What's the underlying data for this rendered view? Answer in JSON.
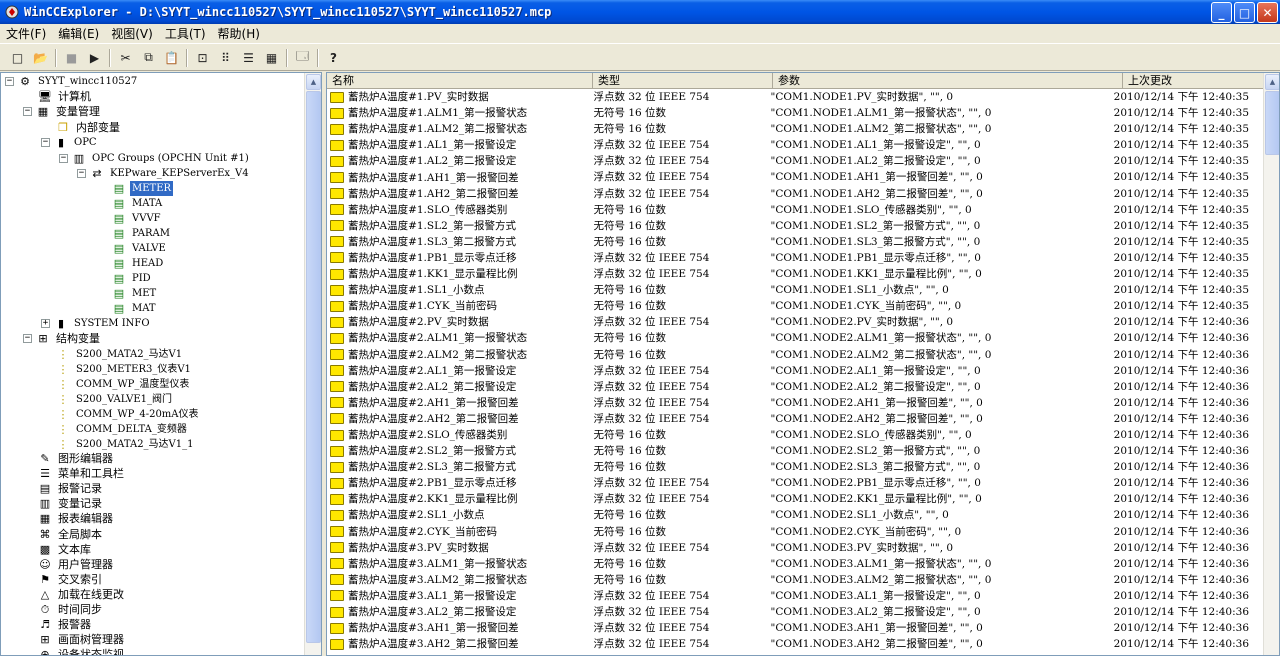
{
  "window": {
    "title": "WinCCExplorer - D:\\SYYT_wincc110527\\SYYT_wincc110527\\SYYT_wincc110527.mcp",
    "min_label": "_",
    "max_label": "□",
    "close_label": "✕"
  },
  "menubar": [
    "文件(F)",
    "编辑(E)",
    "视图(V)",
    "工具(T)",
    "帮助(H)"
  ],
  "toolbar": {
    "new_icon": "□",
    "open_icon": "📂",
    "stop_icon": "■",
    "run_icon": "▶",
    "cut_icon": "✂",
    "copy_icon": "⧉",
    "paste_icon": "📋",
    "large_icons": "⊡",
    "small_icons": "⠿",
    "list_view": "☰",
    "details_view": "▦",
    "properties_icon": "🗔",
    "help_icon": "?"
  },
  "tree": {
    "root": "SYYT_wincc110527",
    "computer": "计算机",
    "tag_management": "变量管理",
    "internal_tags": "内部变量",
    "opc": "OPC",
    "opc_groups": "OPC Groups (OPCHN Unit #1)",
    "kepware": "KEPware_KEPServerEx_V4",
    "groups": [
      "METER",
      "MATA",
      "VVVF",
      "PARAM",
      "VALVE",
      "HEAD",
      "PID",
      "MET",
      "MAT"
    ],
    "selected_group": "METER",
    "system_info": "SYSTEM INFO",
    "struct_tags": "结构变量",
    "structs": [
      "S200_MATA2_马达V1",
      "S200_METER3_仪表V1",
      "COMM_WP_温度型仪表",
      "S200_VALVE1_阀门",
      "COMM_WP_4-20mA仪表",
      "COMM_DELTA_变频器",
      "S200_MATA2_马达V1_1"
    ],
    "editors": [
      "图形编辑器",
      "菜单和工具栏",
      "报警记录",
      "变量记录",
      "报表编辑器",
      "全局脚本",
      "文本库",
      "用户管理器",
      "交叉索引",
      "加载在线更改",
      "时间同步",
      "报警器",
      "画面树管理器",
      "设备状态监视"
    ]
  },
  "list": {
    "headers": [
      "名称",
      "类型",
      "参数",
      "上次更改"
    ],
    "rows": [
      [
        "蓄热炉A温度#1.PV_实时数据",
        "浮点数 32 位 IEEE 754",
        "\"COM1.NODE1.PV_实时数据\", \"\", 0",
        "2010/12/14 下午 12:40:35"
      ],
      [
        "蓄热炉A温度#1.ALM1_第一报警状态",
        "无符号 16 位数",
        "\"COM1.NODE1.ALM1_第一报警状态\", \"\", 0",
        "2010/12/14 下午 12:40:35"
      ],
      [
        "蓄热炉A温度#1.ALM2_第二报警状态",
        "无符号 16 位数",
        "\"COM1.NODE1.ALM2_第二报警状态\", \"\", 0",
        "2010/12/14 下午 12:40:35"
      ],
      [
        "蓄热炉A温度#1.AL1_第一报警设定",
        "浮点数 32 位 IEEE 754",
        "\"COM1.NODE1.AL1_第一报警设定\", \"\", 0",
        "2010/12/14 下午 12:40:35"
      ],
      [
        "蓄热炉A温度#1.AL2_第二报警设定",
        "浮点数 32 位 IEEE 754",
        "\"COM1.NODE1.AL2_第二报警设定\", \"\", 0",
        "2010/12/14 下午 12:40:35"
      ],
      [
        "蓄热炉A温度#1.AH1_第一报警回差",
        "浮点数 32 位 IEEE 754",
        "\"COM1.NODE1.AH1_第一报警回差\", \"\", 0",
        "2010/12/14 下午 12:40:35"
      ],
      [
        "蓄热炉A温度#1.AH2_第二报警回差",
        "浮点数 32 位 IEEE 754",
        "\"COM1.NODE1.AH2_第二报警回差\", \"\", 0",
        "2010/12/14 下午 12:40:35"
      ],
      [
        "蓄热炉A温度#1.SLO_传感器类别",
        "无符号 16 位数",
        "\"COM1.NODE1.SLO_传感器类别\", \"\", 0",
        "2010/12/14 下午 12:40:35"
      ],
      [
        "蓄热炉A温度#1.SL2_第一报警方式",
        "无符号 16 位数",
        "\"COM1.NODE1.SL2_第一报警方式\", \"\", 0",
        "2010/12/14 下午 12:40:35"
      ],
      [
        "蓄热炉A温度#1.SL3_第二报警方式",
        "无符号 16 位数",
        "\"COM1.NODE1.SL3_第二报警方式\", \"\", 0",
        "2010/12/14 下午 12:40:35"
      ],
      [
        "蓄热炉A温度#1.PB1_显示零点迁移",
        "浮点数 32 位 IEEE 754",
        "\"COM1.NODE1.PB1_显示零点迁移\", \"\", 0",
        "2010/12/14 下午 12:40:35"
      ],
      [
        "蓄热炉A温度#1.KK1_显示量程比例",
        "浮点数 32 位 IEEE 754",
        "\"COM1.NODE1.KK1_显示量程比例\", \"\", 0",
        "2010/12/14 下午 12:40:35"
      ],
      [
        "蓄热炉A温度#1.SL1_小数点",
        "无符号 16 位数",
        "\"COM1.NODE1.SL1_小数点\", \"\", 0",
        "2010/12/14 下午 12:40:35"
      ],
      [
        "蓄热炉A温度#1.CYK_当前密码",
        "无符号 16 位数",
        "\"COM1.NODE1.CYK_当前密码\", \"\", 0",
        "2010/12/14 下午 12:40:35"
      ],
      [
        "蓄热炉A温度#2.PV_实时数据",
        "浮点数 32 位 IEEE 754",
        "\"COM1.NODE2.PV_实时数据\", \"\", 0",
        "2010/12/14 下午 12:40:36"
      ],
      [
        "蓄热炉A温度#2.ALM1_第一报警状态",
        "无符号 16 位数",
        "\"COM1.NODE2.ALM1_第一报警状态\", \"\", 0",
        "2010/12/14 下午 12:40:36"
      ],
      [
        "蓄热炉A温度#2.ALM2_第二报警状态",
        "无符号 16 位数",
        "\"COM1.NODE2.ALM2_第二报警状态\", \"\", 0",
        "2010/12/14 下午 12:40:36"
      ],
      [
        "蓄热炉A温度#2.AL1_第一报警设定",
        "浮点数 32 位 IEEE 754",
        "\"COM1.NODE2.AL1_第一报警设定\", \"\", 0",
        "2010/12/14 下午 12:40:36"
      ],
      [
        "蓄热炉A温度#2.AL2_第二报警设定",
        "浮点数 32 位 IEEE 754",
        "\"COM1.NODE2.AL2_第二报警设定\", \"\", 0",
        "2010/12/14 下午 12:40:36"
      ],
      [
        "蓄热炉A温度#2.AH1_第一报警回差",
        "浮点数 32 位 IEEE 754",
        "\"COM1.NODE2.AH1_第一报警回差\", \"\", 0",
        "2010/12/14 下午 12:40:36"
      ],
      [
        "蓄热炉A温度#2.AH2_第二报警回差",
        "浮点数 32 位 IEEE 754",
        "\"COM1.NODE2.AH2_第二报警回差\", \"\", 0",
        "2010/12/14 下午 12:40:36"
      ],
      [
        "蓄热炉A温度#2.SLO_传感器类别",
        "无符号 16 位数",
        "\"COM1.NODE2.SLO_传感器类别\", \"\", 0",
        "2010/12/14 下午 12:40:36"
      ],
      [
        "蓄热炉A温度#2.SL2_第一报警方式",
        "无符号 16 位数",
        "\"COM1.NODE2.SL2_第一报警方式\", \"\", 0",
        "2010/12/14 下午 12:40:36"
      ],
      [
        "蓄热炉A温度#2.SL3_第二报警方式",
        "无符号 16 位数",
        "\"COM1.NODE2.SL3_第二报警方式\", \"\", 0",
        "2010/12/14 下午 12:40:36"
      ],
      [
        "蓄热炉A温度#2.PB1_显示零点迁移",
        "浮点数 32 位 IEEE 754",
        "\"COM1.NODE2.PB1_显示零点迁移\", \"\", 0",
        "2010/12/14 下午 12:40:36"
      ],
      [
        "蓄热炉A温度#2.KK1_显示量程比例",
        "浮点数 32 位 IEEE 754",
        "\"COM1.NODE2.KK1_显示量程比例\", \"\", 0",
        "2010/12/14 下午 12:40:36"
      ],
      [
        "蓄热炉A温度#2.SL1_小数点",
        "无符号 16 位数",
        "\"COM1.NODE2.SL1_小数点\", \"\", 0",
        "2010/12/14 下午 12:40:36"
      ],
      [
        "蓄热炉A温度#2.CYK_当前密码",
        "无符号 16 位数",
        "\"COM1.NODE2.CYK_当前密码\", \"\", 0",
        "2010/12/14 下午 12:40:36"
      ],
      [
        "蓄热炉A温度#3.PV_实时数据",
        "浮点数 32 位 IEEE 754",
        "\"COM1.NODE3.PV_实时数据\", \"\", 0",
        "2010/12/14 下午 12:40:36"
      ],
      [
        "蓄热炉A温度#3.ALM1_第一报警状态",
        "无符号 16 位数",
        "\"COM1.NODE3.ALM1_第一报警状态\", \"\", 0",
        "2010/12/14 下午 12:40:36"
      ],
      [
        "蓄热炉A温度#3.ALM2_第二报警状态",
        "无符号 16 位数",
        "\"COM1.NODE3.ALM2_第二报警状态\", \"\", 0",
        "2010/12/14 下午 12:40:36"
      ],
      [
        "蓄热炉A温度#3.AL1_第一报警设定",
        "浮点数 32 位 IEEE 754",
        "\"COM1.NODE3.AL1_第一报警设定\", \"\", 0",
        "2010/12/14 下午 12:40:36"
      ],
      [
        "蓄热炉A温度#3.AL2_第二报警设定",
        "浮点数 32 位 IEEE 754",
        "\"COM1.NODE3.AL2_第二报警设定\", \"\", 0",
        "2010/12/14 下午 12:40:36"
      ],
      [
        "蓄热炉A温度#3.AH1_第一报警回差",
        "浮点数 32 位 IEEE 754",
        "\"COM1.NODE3.AH1_第一报警回差\", \"\", 0",
        "2010/12/14 下午 12:40:36"
      ],
      [
        "蓄热炉A温度#3.AH2_第二报警回差",
        "浮点数 32 位 IEEE 754",
        "\"COM1.NODE3.AH2_第二报警回差\", \"\", 0",
        "2010/12/14 下午 12:40:36"
      ]
    ]
  }
}
